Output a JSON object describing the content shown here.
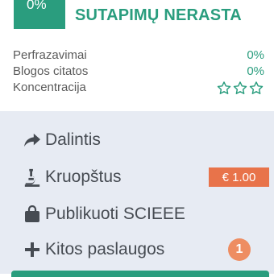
{
  "header": {
    "score": "0%",
    "subtitle": "",
    "title": "SUTAPIMŲ NERASTA"
  },
  "stats": [
    {
      "label": "Perfrazavimai",
      "value": "0%"
    },
    {
      "label": "Blogos citatos",
      "value": "0%"
    },
    {
      "label": "Koncentracija",
      "stars": 0,
      "stars_total": 3
    }
  ],
  "menu": {
    "share": "Dalintis",
    "careful": "Kruopštus",
    "careful_price": "€ 1.00",
    "publish": "Publikuoti SCIEEE",
    "more": "Kitos paslaugos",
    "more_count": "1"
  },
  "colors": {
    "accent": "#2a9d7e",
    "price": "#e8734a",
    "count": "#ee8d62",
    "panel": "#e7ebf3"
  }
}
